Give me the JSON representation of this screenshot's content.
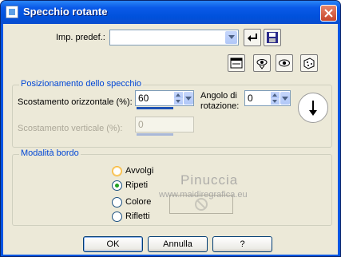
{
  "window": {
    "title": "Specchio rotante"
  },
  "preset": {
    "label": "Imp. predef.:",
    "value": ""
  },
  "mirror_group": {
    "title": "Posizionamento dello specchio",
    "horizontal_offset_label": "Scostamento orizzontale (%):",
    "horizontal_offset_value": "60",
    "rotation_label_1": "Angolo di",
    "rotation_label_2": "rotazione:",
    "rotation_value": "0",
    "vertical_offset_label": "Scostamento verticale (%):",
    "vertical_offset_value": "0"
  },
  "border_group": {
    "title": "Modalità bordo",
    "options": [
      "Avvolgi",
      "Ripeti",
      "Colore",
      "Rifletti"
    ],
    "selected": "Ripeti"
  },
  "watermark": {
    "line1": "Pinuccia",
    "line2": "www.maidiregrafica.eu"
  },
  "buttons": {
    "ok": "OK",
    "cancel": "Annulla",
    "help": "?"
  }
}
